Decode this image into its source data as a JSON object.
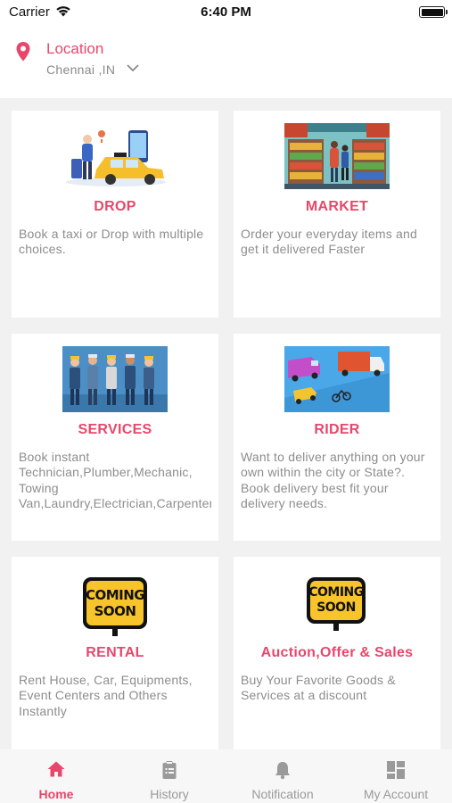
{
  "status_bar": {
    "carrier": "Carrier",
    "time": "6:40 PM"
  },
  "location": {
    "title": "Location",
    "city": "Chennai ,IN"
  },
  "services": [
    {
      "title": "DROP",
      "description": "Book a taxi or Drop with multiple choices.",
      "image": "taxi-illustration"
    },
    {
      "title": "MARKET",
      "description": "Order your everyday items and get it delivered Faster",
      "image": "market-illustration"
    },
    {
      "title": "SERVICES",
      "description": "Book instant Technician,Plumber,Mechanic, Towing Van,Laundry,Electrician,Carpenter",
      "image": "technicians-illustration"
    },
    {
      "title": "RIDER",
      "description": "Want to deliver anything on your own within the city or State?. Book delivery best fit your delivery needs.",
      "image": "delivery-vehicles-illustration"
    },
    {
      "title": "RENTAL",
      "description": "Rent House, Car, Equipments, Event Centers and Others Instantly",
      "image": "coming-soon-sign",
      "badge": [
        "COMING",
        "SOON"
      ]
    },
    {
      "title": "Auction,Offer & Sales",
      "description": "Buy Your Favorite Goods & Services at a discount",
      "image": "coming-soon-sign",
      "badge": [
        "COMING",
        "SOON"
      ]
    }
  ],
  "tabs": [
    {
      "label": "Home",
      "icon": "home-icon",
      "active": true
    },
    {
      "label": "History",
      "icon": "clipboard-icon"
    },
    {
      "label": "Notification",
      "icon": "bell-icon"
    },
    {
      "label": "My Account",
      "icon": "dashboard-icon"
    }
  ],
  "colors": {
    "accent": "#e8476b",
    "muted_text": "#8d8d8d",
    "background": "#f1f1f1"
  }
}
